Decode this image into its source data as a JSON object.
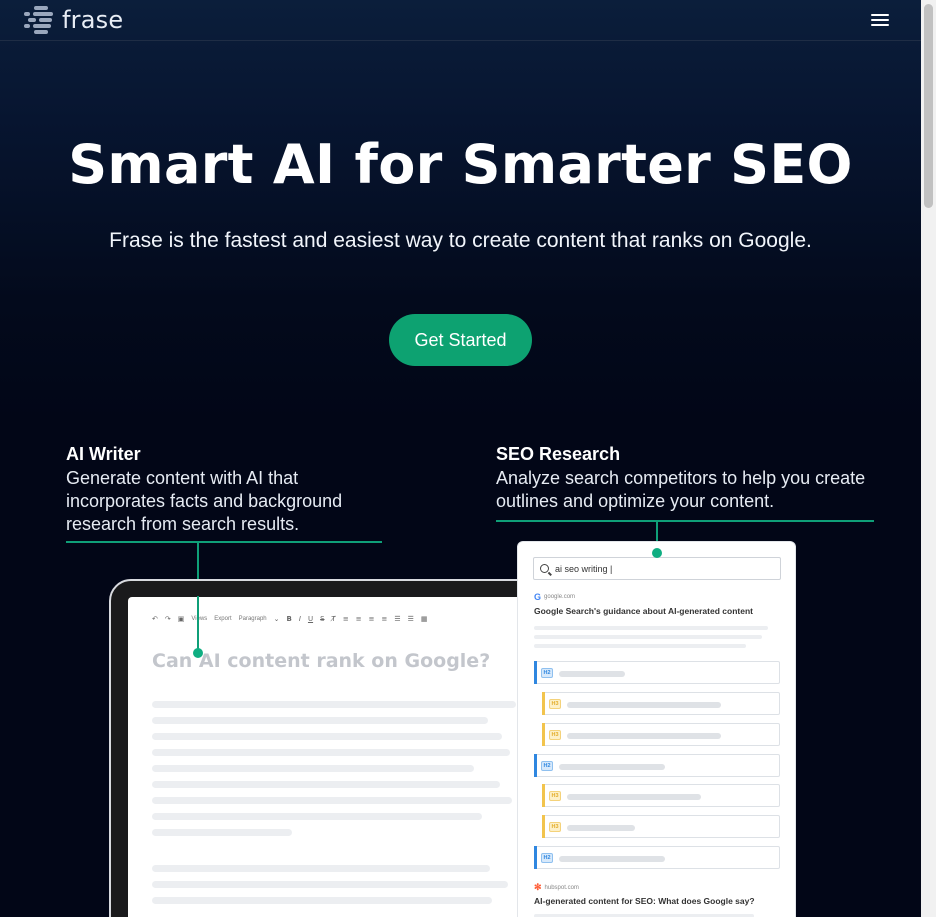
{
  "header": {
    "logo_text": "frase",
    "menu_icon": "hamburger-menu-icon"
  },
  "hero": {
    "title": "Smart AI for Smarter SEO",
    "subtitle": "Frase is the fastest and easiest way to create content that ranks on Google.",
    "cta_label": "Get Started"
  },
  "features": {
    "ai_writer": {
      "title": "AI Writer",
      "description": "Generate content with AI that incorporates facts and background research from search results."
    },
    "seo_research": {
      "title": "SEO Research",
      "description": "Analyze search competitors to help you create outlines and optimize your content."
    }
  },
  "editor": {
    "toolbar": {
      "views": "Views",
      "export": "Export",
      "paragraph": "Paragraph",
      "bold": "B",
      "italic": "I",
      "underline": "U",
      "strike": "S"
    },
    "doc_title": "Can AI content rank on Google?"
  },
  "seo_panel": {
    "search_query": "ai seo writing |",
    "results": [
      {
        "domain": "google.com",
        "title": "Google Search's guidance about AI-generated content"
      },
      {
        "domain": "hubspot.com",
        "title": "AI-generated content for SEO: What does Google say?"
      }
    ],
    "headings": [
      {
        "level": "H2"
      },
      {
        "level": "H3"
      },
      {
        "level": "H3"
      },
      {
        "level": "H2"
      },
      {
        "level": "H3"
      },
      {
        "level": "H3"
      },
      {
        "level": "H2"
      }
    ]
  },
  "colors": {
    "accent": "#0da271",
    "background": "#020617",
    "h2_tag": "#2f87e0",
    "h3_tag": "#f2c44d"
  }
}
